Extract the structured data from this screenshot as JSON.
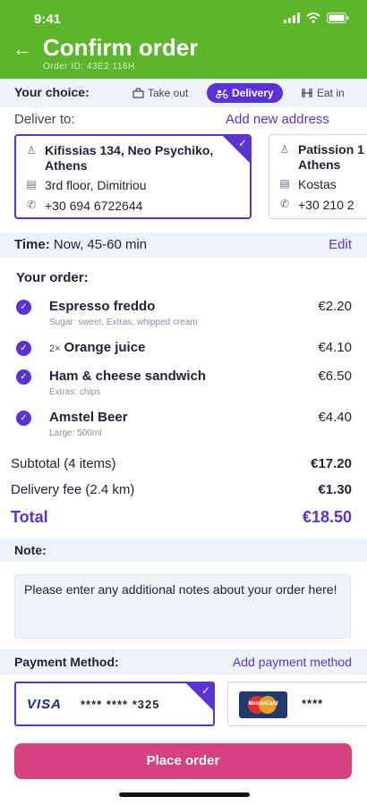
{
  "status_bar": {
    "time": "9:41"
  },
  "header": {
    "title": "Confirm order",
    "order_id": "Order ID: 43E2 116H"
  },
  "choice": {
    "label": "Your choice:",
    "options": [
      {
        "label": "Take out",
        "icon": "bag-icon",
        "selected": false
      },
      {
        "label": "Delivery",
        "icon": "scooter-icon",
        "selected": true
      },
      {
        "label": "Eat in",
        "icon": "dining-icon",
        "selected": false
      }
    ]
  },
  "delivery": {
    "label": "Deliver to:",
    "add_address": "Add new address",
    "addresses": [
      {
        "street": "Kifissias 134, Neo Psychiko, Athens",
        "floor": "3rd floor, Dimitriou",
        "phone": "+30 694 6722644",
        "selected": true
      },
      {
        "street": "Patission 1 Athens",
        "floor": "Kostas",
        "phone": "+30 210 2",
        "selected": false
      }
    ]
  },
  "time": {
    "label": "Time:",
    "value": "Now, 45-60 min",
    "edit": "Edit"
  },
  "order": {
    "heading": "Your order:",
    "items": [
      {
        "qty": "",
        "name": "Espresso freddo",
        "extras": "Sugar: sweet, Extras: whipped cream",
        "price": "€2.20"
      },
      {
        "qty": "2×",
        "name": "Orange juice",
        "extras": "",
        "price": "€4.10"
      },
      {
        "qty": "",
        "name": "Ham & cheese sandwich",
        "extras": "Extras: chips",
        "price": "€6.50"
      },
      {
        "qty": "",
        "name": "Amstel Beer",
        "extras": "Large: 500ml",
        "price": "€4.40"
      }
    ],
    "subtotal_label": "Subtotal (4 items)",
    "subtotal_value": "€17.20",
    "delivery_fee_label": "Delivery fee (2.4 km)",
    "delivery_fee_value": "€1.30",
    "total_label": "Total",
    "total_value": "€18.50"
  },
  "note": {
    "label": "Note:",
    "placeholder": "Please enter any additional notes about your order here!"
  },
  "payment": {
    "label": "Payment Method:",
    "add": "Add payment method",
    "cards": [
      {
        "brand": "VISA",
        "masked": "**** **** *325",
        "selected": true
      },
      {
        "brand": "MasterCard",
        "masked": "****",
        "selected": false
      }
    ]
  },
  "place_order": "Place order",
  "colors": {
    "header_green": "#5cb52a",
    "accent_purple": "#5b32d6",
    "button_pink": "#d6417f",
    "band": "#eef3f9"
  }
}
